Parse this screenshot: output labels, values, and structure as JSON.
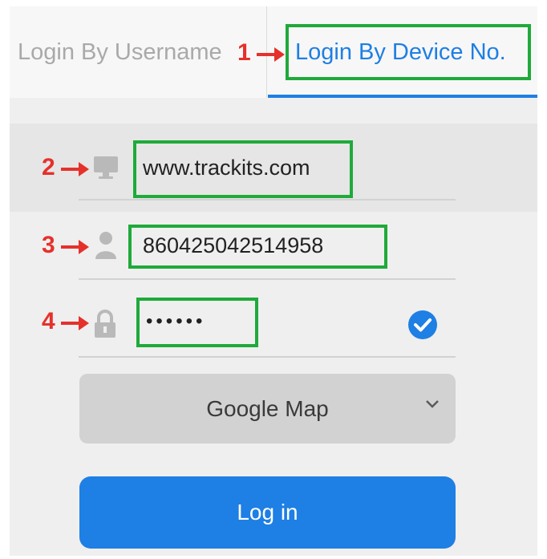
{
  "tabs": {
    "username_label": "Login By Username",
    "device_label": "Login By Device No."
  },
  "annotations": [
    "1",
    "2",
    "3",
    "4"
  ],
  "fields": {
    "server": {
      "value": "www.trackits.com",
      "icon": "monitor-icon"
    },
    "device_no": {
      "value": "860425042514958",
      "icon": "user-icon"
    },
    "password": {
      "value": "••••••",
      "icon": "lock-icon",
      "remember": "checkmark-circle-icon"
    }
  },
  "map_select": {
    "selected": "Google Map"
  },
  "login_button": {
    "label": "Log in"
  },
  "colors": {
    "accent": "#1e7fe4",
    "annotation_red": "#e5312b",
    "highlight_green": "#1faa3a"
  }
}
